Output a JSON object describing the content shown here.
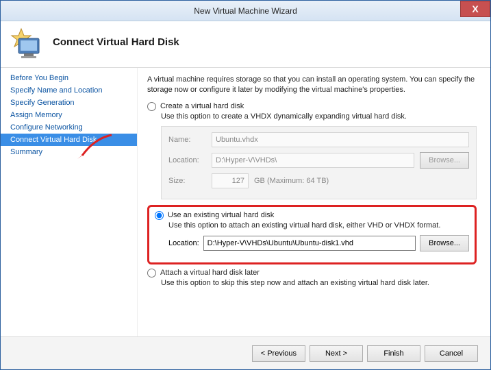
{
  "window": {
    "title": "New Virtual Machine Wizard",
    "close": "X"
  },
  "header": {
    "title": "Connect Virtual Hard Disk"
  },
  "sidebar": {
    "items": [
      {
        "label": "Before You Begin"
      },
      {
        "label": "Specify Name and Location"
      },
      {
        "label": "Specify Generation"
      },
      {
        "label": "Assign Memory"
      },
      {
        "label": "Configure Networking"
      },
      {
        "label": "Connect Virtual Hard Disk"
      },
      {
        "label": "Summary"
      }
    ]
  },
  "content": {
    "intro": "A virtual machine requires storage so that you can install an operating system. You can specify the storage now or configure it later by modifying the virtual machine's properties.",
    "create": {
      "label": "Create a virtual hard disk",
      "desc": "Use this option to create a VHDX dynamically expanding virtual hard disk.",
      "name_label": "Name:",
      "name_value": "Ubuntu.vhdx",
      "location_label": "Location:",
      "location_value": "D:\\Hyper-V\\VHDs\\",
      "browse": "Browse...",
      "size_label": "Size:",
      "size_value": "127",
      "size_unit": "GB (Maximum: 64 TB)"
    },
    "existing": {
      "label": "Use an existing virtual hard disk",
      "desc": "Use this option to attach an existing virtual hard disk, either VHD or VHDX format.",
      "location_label": "Location:",
      "location_value": "D:\\Hyper-V\\VHDs\\Ubuntu\\Ubuntu-disk1.vhd",
      "browse": "Browse..."
    },
    "later": {
      "label": "Attach a virtual hard disk later",
      "desc": "Use this option to skip this step now and attach an existing virtual hard disk later."
    }
  },
  "footer": {
    "previous": "< Previous",
    "next": "Next >",
    "finish": "Finish",
    "cancel": "Cancel"
  }
}
